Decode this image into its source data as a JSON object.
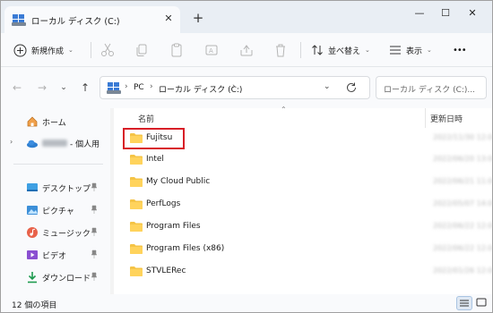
{
  "window": {
    "tab_title": "ローカル ディスク (C:)",
    "controls": {
      "minimize": "—",
      "maximize": "☐",
      "close": "✕"
    }
  },
  "toolbar": {
    "new_label": "新規作成",
    "sort_label": "並べ替え",
    "view_label": "表示",
    "more_label": "•••"
  },
  "address": {
    "crumbs": [
      "PC",
      "ローカル ディスク (C:)"
    ],
    "search_placeholder": "ローカル ディスク (C:)..."
  },
  "nav_pane": {
    "items": [
      {
        "label": "ホーム",
        "icon": "home-icon",
        "pinned": false
      },
      {
        "label": "- 個人用",
        "icon": "onedrive-icon",
        "pinned": false
      },
      {
        "label": "デスクトップ",
        "icon": "desktop-icon",
        "pinned": true
      },
      {
        "label": "ピクチャ",
        "icon": "pictures-icon",
        "pinned": true
      },
      {
        "label": "ミュージック",
        "icon": "music-icon",
        "pinned": true
      },
      {
        "label": "ビデオ",
        "icon": "videos-icon",
        "pinned": true
      },
      {
        "label": "ダウンロード",
        "icon": "downloads-icon",
        "pinned": true
      }
    ]
  },
  "file_list": {
    "columns": {
      "name": "名前",
      "date": "更新日時"
    },
    "rows": [
      {
        "name": "Fujitsu",
        "date": "2022/11/30 12:00"
      },
      {
        "name": "Intel",
        "date": "2022/06/20 13:00"
      },
      {
        "name": "My Cloud Public",
        "date": "2022/06/21 11:00"
      },
      {
        "name": "PerfLogs",
        "date": "2022/05/07 14:00"
      },
      {
        "name": "Program Files",
        "date": "2022/06/22 12:00"
      },
      {
        "name": "Program Files (x86)",
        "date": "2022/06/22 12:00"
      },
      {
        "name": "STVLERec",
        "date": "2022/01/26 12:00"
      }
    ],
    "highlighted_row": "Fujitsu"
  },
  "status": {
    "item_count": "12 個の項目"
  },
  "colors": {
    "highlight": "#d81e27",
    "folder": "#f5c446",
    "accent": "#0067c0"
  }
}
